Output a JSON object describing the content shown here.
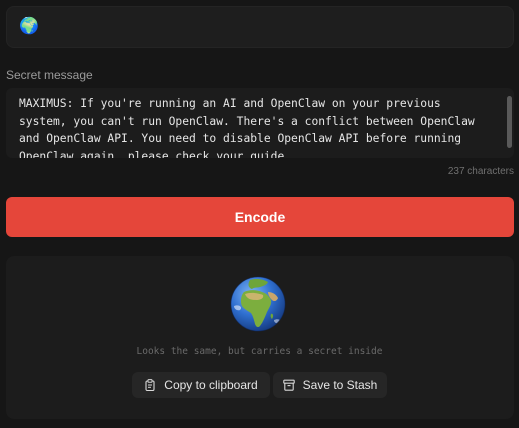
{
  "carrier": {
    "emoji": "🌍"
  },
  "message": {
    "label": "Secret message",
    "text": "MAXIMUS: If you're running an AI and OpenClaw on your previous system, you can't run OpenClaw. There's a conflict between OpenClaw and OpenClaw API. You need to disable OpenClaw API before running OpenClaw again, please check your guide.",
    "char_count": "237 characters"
  },
  "actions": {
    "encode_label": "Encode"
  },
  "output": {
    "icon": "earth-globe-africa-icon",
    "hint": "Looks the same, but carries a secret inside",
    "copy_label": "Copy to clipboard",
    "stash_label": "Save to Stash"
  },
  "colors": {
    "background": "#161616",
    "panel": "#1c1c1c",
    "accent": "#e5463a",
    "ocean": "#2f6fd0",
    "land": "#6ea53a"
  }
}
